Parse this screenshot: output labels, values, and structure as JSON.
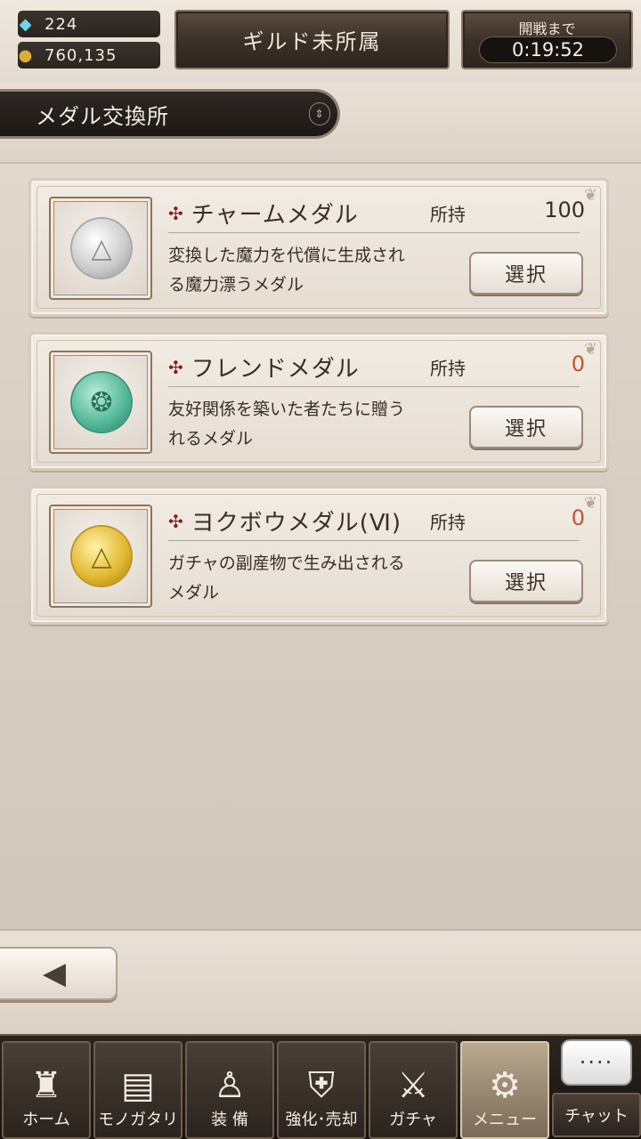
{
  "header": {
    "gems": "224",
    "gold": "760,135",
    "guild_label": "ギルド未所属",
    "battle_label": "開戦まで",
    "battle_timer": "0:19:52"
  },
  "section": {
    "title": "メダル交換所"
  },
  "medals": [
    {
      "name": "チャームメダル",
      "own_label": "所持",
      "count": "100",
      "desc_line1": "変換した魔力を代償に生成され",
      "desc_line2": "る魔力漂うメダル",
      "select_label": "選択",
      "style": "silver"
    },
    {
      "name": "フレンドメダル",
      "own_label": "所持",
      "count": "0",
      "desc_line1": "友好関係を築いた者たちに贈う",
      "desc_line2": "れるメダル",
      "select_label": "選択",
      "style": "green"
    },
    {
      "name": "ヨクボウメダル(Ⅵ)",
      "own_label": "所持",
      "count": "0",
      "desc_line1": "ガチャの副産物で生み出される",
      "desc_line2": "メダル",
      "select_label": "選択",
      "style": "gold"
    }
  ],
  "nav": {
    "items": [
      {
        "label": "ホーム",
        "icon": "castle-icon"
      },
      {
        "label": "モノガタリ",
        "icon": "book-icon"
      },
      {
        "label": "装 備",
        "icon": "puppet-icon"
      },
      {
        "label": "強化･売却",
        "icon": "helmet-icon"
      },
      {
        "label": "ガチャ",
        "icon": "swords-icon"
      },
      {
        "label": "メニュー",
        "icon": "gears-icon"
      }
    ],
    "chat_label": "チャット",
    "chat_bubble": "····"
  },
  "colors": {
    "zero_count": "#c9522b",
    "cross": "#8b1c17"
  }
}
